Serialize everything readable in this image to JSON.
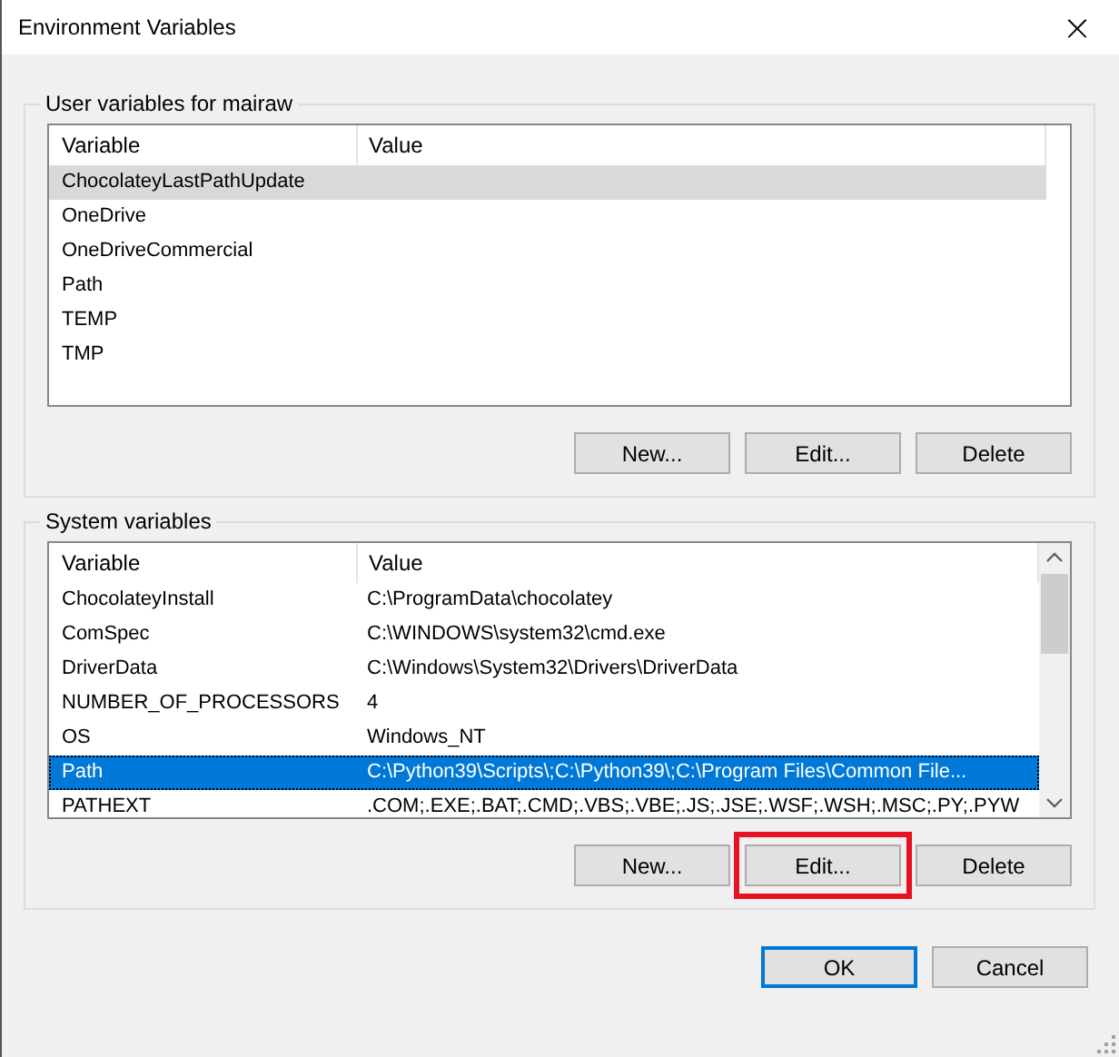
{
  "window": {
    "title": "Environment Variables",
    "close": "×"
  },
  "user_variables": {
    "title": "User variables for mairaw",
    "focused": false,
    "columns": [
      "Variable",
      "Value"
    ],
    "rows": [
      {
        "variable": "ChocolateyLastPathUpdate",
        "selected": true
      },
      {
        "variable": "OneDrive",
        "selected": false
      },
      {
        "variable": "OneDriveCommercial",
        "selected": false
      },
      {
        "variable": "Path",
        "selected": false
      },
      {
        "variable": "TEMP",
        "selected": false
      },
      {
        "variable": "TMP",
        "selected": false
      }
    ],
    "buttons": [
      {
        "label": "New...",
        "highlighted": false
      },
      {
        "label": "Edit...",
        "highlighted": false
      },
      {
        "label": "Delete",
        "highlighted": false
      }
    ]
  },
  "system_variables": {
    "title": "System variables",
    "focused": true,
    "columns": [
      "Variable",
      "Value"
    ],
    "rows": [
      {
        "variable": "ChocolateyInstall",
        "value": "C:\\ProgramData\\chocolatey",
        "selected": false
      },
      {
        "variable": "ComSpec",
        "value": "C:\\WINDOWS\\system32\\cmd.exe",
        "selected": false
      },
      {
        "variable": "DriverData",
        "value": "C:\\Windows\\System32\\Drivers\\DriverData",
        "selected": false
      },
      {
        "variable": "NUMBER_OF_PROCESSORS",
        "value": "4",
        "selected": false
      },
      {
        "variable": "OS",
        "value": "Windows_NT",
        "selected": false
      },
      {
        "variable": "Path",
        "value": "C:\\Python39\\Scripts\\;C:\\Python39\\;C:\\Program Files\\Common File...",
        "selected": true
      },
      {
        "variable": "PATHEXT",
        "value": ".COM;.EXE;.BAT;.CMD;.VBS;.VBE;.JS;.JSE;.WSF;.WSH;.MSC;.PY;.PYW",
        "selected": false
      }
    ],
    "buttons": [
      {
        "label": "New...",
        "highlighted": false
      },
      {
        "label": "Edit...",
        "highlighted": true
      },
      {
        "label": "Delete",
        "highlighted": false
      }
    ]
  },
  "dialog_buttons": [
    {
      "label": "OK",
      "default": true
    },
    {
      "label": "Cancel",
      "default": false
    }
  ]
}
